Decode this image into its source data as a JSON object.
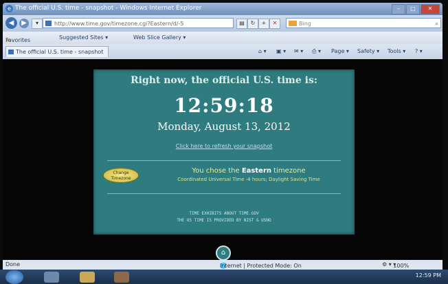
{
  "browser": {
    "window_title": "The official U.S. time - snapshot - Windows Internet Explorer",
    "address_url": "http://www.time.gov/timezone.cgi?Eastern/d/-5",
    "search_provider": "Bing",
    "favorites_label": "Favorites",
    "favorites_items": [
      "Suggested Sites ▾",
      "Web Slice Gallery ▾"
    ],
    "tab_title": "The official U.S. time - snapshot",
    "command_items": [
      "Page ▾",
      "Safety ▾",
      "Tools ▾"
    ],
    "status_left": "Done",
    "status_zone": "Internet | Protected Mode: On",
    "status_zoom": "100%"
  },
  "page": {
    "headline": "Right now, the official U.S. time is:",
    "clock": "12:59:18",
    "date": "Monday, August 13, 2012",
    "refresh_link": "Click here to refresh your snapshot",
    "change_button_line1": "Change",
    "change_button_line2": "Timezone",
    "tz_prefix": "You chose the ",
    "tz_name": "Eastern",
    "tz_suffix": " timezone",
    "utc_line": "Coordinated Universal Time -4 hours; Daylight Saving Time",
    "footer_line1": "TIME EXHIBITS    ABOUT TIME.GOV",
    "footer_line2": "THE US TIME IS PROVIDED BY NIST & USNO"
  },
  "taskbar": {
    "clock": "12:59 PM"
  },
  "colors": {
    "panel": "#2e7c80",
    "headline": "#d8efe9",
    "tz_text": "#e8f19a"
  }
}
